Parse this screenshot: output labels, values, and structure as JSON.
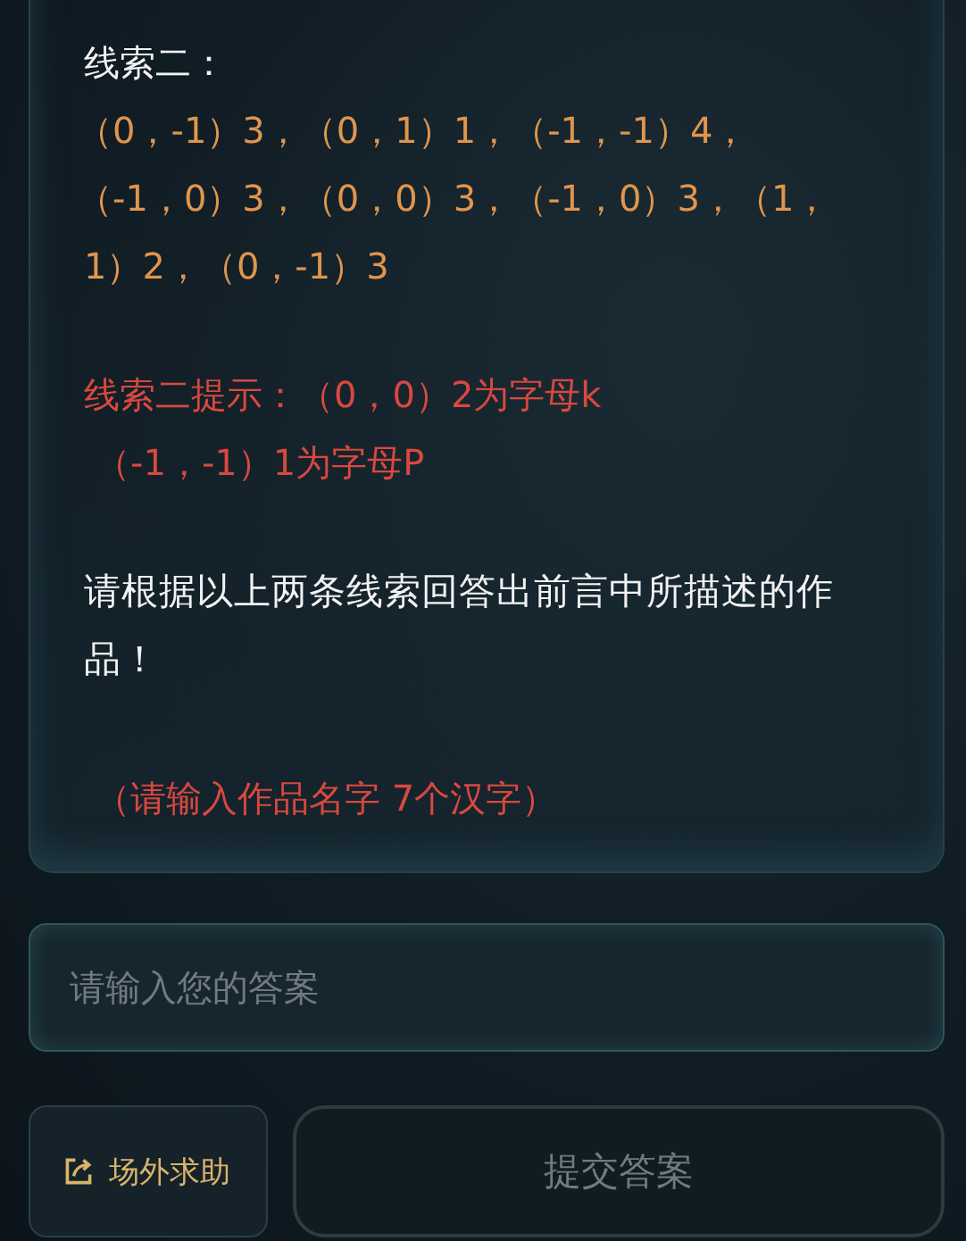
{
  "clue": {
    "title": "线索二：",
    "lines": [
      "（0，-1）3，（0，1）1，（-1，-1）4，",
      "（-1，0）3，（0，0）3，（-1，0）3，（1，",
      "1）2，（0，-1）3"
    ]
  },
  "hint": {
    "lines": [
      "线索二提示：（0，0）2为字母k",
      "（-1，-1）1为字母P"
    ]
  },
  "question": "请根据以上两条线索回答出前言中所描述的作品！",
  "note": "（请输入作品名字 7个汉字）",
  "answer": {
    "placeholder": "请输入您的答案"
  },
  "buttons": [
    {
      "kind": "help",
      "label": "场外求助",
      "disabled": false
    },
    {
      "kind": "submit",
      "label": "提交答案",
      "disabled": true
    }
  ]
}
